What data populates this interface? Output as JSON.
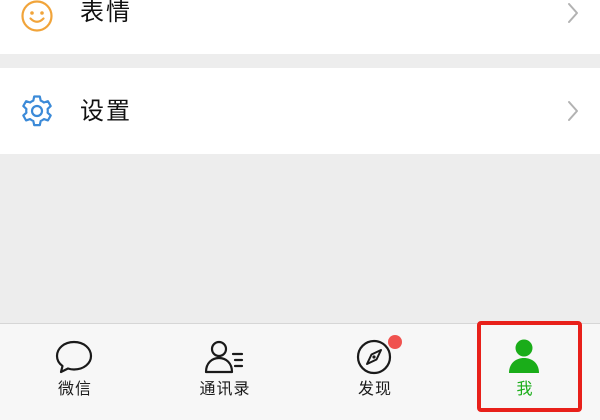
{
  "menu": {
    "items": [
      {
        "label": "表情",
        "icon": "smiley-icon",
        "icon_color": "#f1a43a"
      },
      {
        "label": "设置",
        "icon": "gear-icon",
        "icon_color": "#3b8ad8"
      }
    ]
  },
  "tabbar": {
    "tabs": [
      {
        "label": "微信",
        "icon": "chat-bubble-icon",
        "active": false
      },
      {
        "label": "通讯录",
        "icon": "contacts-icon",
        "active": false
      },
      {
        "label": "发现",
        "icon": "compass-icon",
        "active": false,
        "badge": "dot"
      },
      {
        "label": "我",
        "icon": "person-icon",
        "active": true
      }
    ],
    "active_color": "#1aad19",
    "badge_color": "#f0524f"
  },
  "annotation": {
    "highlight_color": "#e8201a",
    "highlight_target": "我"
  }
}
